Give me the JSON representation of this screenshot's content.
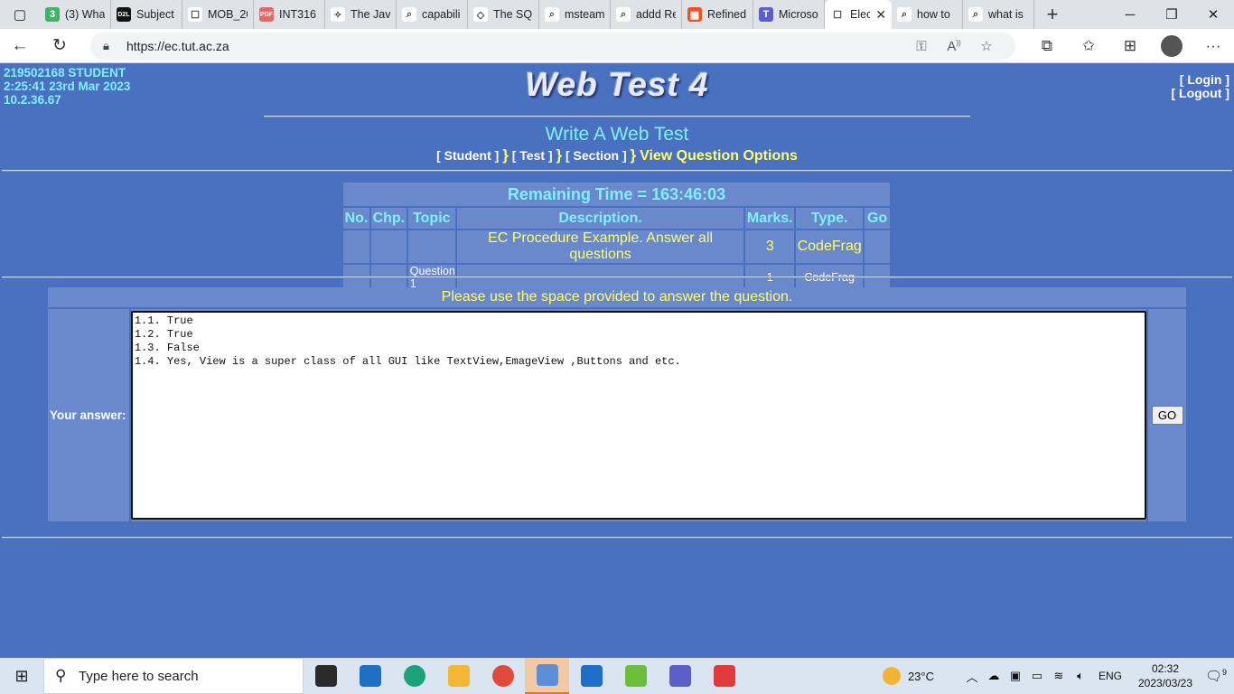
{
  "browser": {
    "tabs": [
      {
        "title": "(3) Wha",
        "fav": "3",
        "favcolor": "#40b36b"
      },
      {
        "title": "Subject",
        "fav": "D2L",
        "favcolor": "#111111"
      },
      {
        "title": "MOB_20",
        "fav": "☐",
        "favcolor": "#ffffff"
      },
      {
        "title": "INT316",
        "fav": "PDF",
        "favcolor": "#e06a6a"
      },
      {
        "title": "The Jav",
        "fav": "✧",
        "favcolor": "#ffffff"
      },
      {
        "title": "capabili",
        "fav": "⌕",
        "favcolor": "#ffffff"
      },
      {
        "title": "The SQ",
        "fav": "◇",
        "favcolor": "#ffffff"
      },
      {
        "title": "msteam",
        "fav": "⌕",
        "favcolor": "#ffffff"
      },
      {
        "title": "addd Re",
        "fav": "⌕",
        "favcolor": "#ffffff"
      },
      {
        "title": "Refined",
        "fav": "▦",
        "favcolor": "#f25022"
      },
      {
        "title": "Microso",
        "fav": "T",
        "favcolor": "#5b5fc7"
      },
      {
        "title": "Elec",
        "fav": "☐",
        "favcolor": "#ffffff",
        "active": true
      },
      {
        "title": "how to",
        "fav": "⌕",
        "favcolor": "#ffffff"
      },
      {
        "title": "what is",
        "fav": "⌕",
        "favcolor": "#ffffff"
      }
    ],
    "url": "https://ec.tut.ac.za"
  },
  "header": {
    "user_id": "219502168 STUDENT",
    "timestamp": "2:25:41 23rd Mar 2023",
    "ip": "10.2.36.67",
    "site_title": "Web Test 4",
    "login": "[ Login ]",
    "logout": "[ Logout ]"
  },
  "nav": {
    "subtitle": "Write A Web Test",
    "crumbs": [
      "[ Student ]",
      "[ Test ]",
      "[ Section ]"
    ],
    "separator": "}",
    "current": "View Question Options"
  },
  "question_table": {
    "timer": "Remaining Time = 163:46:03",
    "headers": [
      "No.",
      "Chp.",
      "Topic",
      "Description.",
      "Marks.",
      "Type.",
      "Go"
    ],
    "section_row": {
      "no": "",
      "chp": "",
      "topic": "",
      "description": "EC Procedure Example. Answer all questions",
      "marks": "3",
      "type": "CodeFrag",
      "go": ""
    },
    "rows": [
      {
        "no": "-",
        "chp": "-",
        "topic": "Question 1",
        "description": "",
        "marks": "1",
        "type": "CodeFrag",
        "go": "-"
      }
    ]
  },
  "answer": {
    "instruction": "Please use the space provided to answer the question.",
    "label": "Your answer:",
    "text": "1.1. True\n1.2. True\n1.3. False\n1.4. Yes, View is a super class of all GUI like TextView,EmageView ,Buttons and etc.",
    "go_label": "GO"
  },
  "taskbar": {
    "search_placeholder": "Type here to search",
    "apps": [
      {
        "name": "task-view",
        "color": "#2b2b2b"
      },
      {
        "name": "mail",
        "color": "#1f6fc5"
      },
      {
        "name": "edge",
        "color": "#1aa37a"
      },
      {
        "name": "file-explorer",
        "color": "#f2b733"
      },
      {
        "name": "chrome",
        "color": "#e04a3a"
      },
      {
        "name": "virtualbox",
        "color": "#5b8ed6",
        "active": true
      },
      {
        "name": "media-player",
        "color": "#1c6ec9"
      },
      {
        "name": "notepad-plus",
        "color": "#6bbf3a"
      },
      {
        "name": "teams",
        "color": "#5b5fc7"
      },
      {
        "name": "vivaldi",
        "color": "#e03a3a"
      }
    ],
    "temperature": "23°C",
    "language": "ENG",
    "time": "02:32",
    "date": "2023/03/23",
    "notifications": "9"
  }
}
